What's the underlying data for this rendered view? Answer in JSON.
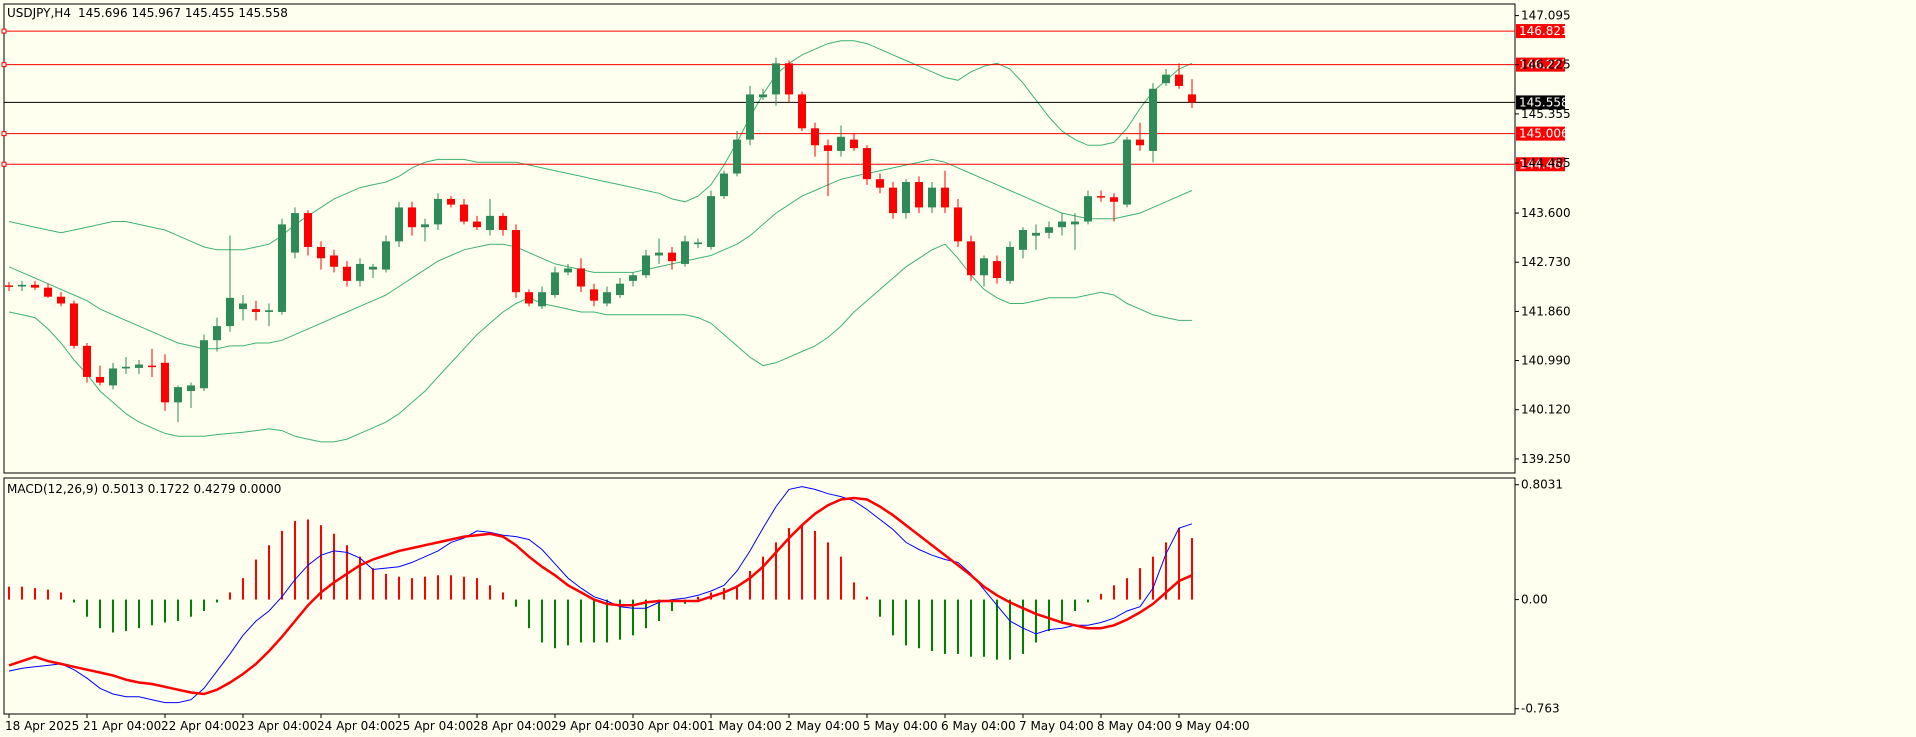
{
  "main_panel": {
    "symbol_label": "USDJPY,H4",
    "ohlc": "145.696 145.967 145.455 145.558",
    "price_ticks": [
      "147.095",
      "146.225",
      "145.355",
      "144.485",
      "143.600",
      "142.730",
      "141.860",
      "140.990",
      "140.120",
      "139.250"
    ],
    "current_price": "145.558",
    "levels": [
      "146.821",
      "146.227",
      "145.006",
      "144.464"
    ]
  },
  "macd_panel": {
    "label": "MACD(12,26,9) 0.5013 0.1722 0.4279 0.0000",
    "ticks": [
      "0.8031",
      "0.00",
      "-0.763"
    ]
  },
  "time_labels": [
    "18 Apr 2025",
    "21 Apr 04:00",
    "22 Apr 04:00",
    "23 Apr 04:00",
    "24 Apr 04:00",
    "25 Apr 04:00",
    "28 Apr 04:00",
    "29 Apr 04:00",
    "30 Apr 04:00",
    "1 May 04:00",
    "2 May 04:00",
    "5 May 04:00",
    "6 May 04:00",
    "7 May 04:00",
    "8 May 04:00",
    "9 May 04:00"
  ],
  "colors": {
    "background": "#fffff0",
    "bull_candle": "#2e8b57",
    "bear_candle": "#ff0000",
    "bollinger": "#3cb371",
    "macd_line": "#0000ff",
    "signal_line": "#ff0000",
    "level_line": "#ff0000",
    "current_line": "#000000"
  },
  "chart_data": {
    "type": "candlestick",
    "symbol": "USDJPY",
    "timeframe": "H4",
    "ylim": [
      139.0,
      147.3
    ],
    "candles": [
      {
        "o": 142.32,
        "h": 142.38,
        "l": 142.22,
        "c": 142.3
      },
      {
        "o": 142.3,
        "h": 142.4,
        "l": 142.22,
        "c": 142.33
      },
      {
        "o": 142.33,
        "h": 142.4,
        "l": 142.24,
        "c": 142.28
      },
      {
        "o": 142.28,
        "h": 142.35,
        "l": 142.1,
        "c": 142.12
      },
      {
        "o": 142.12,
        "h": 142.2,
        "l": 141.95,
        "c": 142.0
      },
      {
        "o": 142.0,
        "h": 142.05,
        "l": 141.2,
        "c": 141.25
      },
      {
        "o": 141.25,
        "h": 141.3,
        "l": 140.6,
        "c": 140.7
      },
      {
        "o": 140.7,
        "h": 140.9,
        "l": 140.55,
        "c": 140.6
      },
      {
        "o": 140.55,
        "h": 140.95,
        "l": 140.48,
        "c": 140.85
      },
      {
        "o": 140.85,
        "h": 141.05,
        "l": 140.75,
        "c": 140.88
      },
      {
        "o": 140.86,
        "h": 141.0,
        "l": 140.75,
        "c": 140.92
      },
      {
        "o": 140.9,
        "h": 141.2,
        "l": 140.7,
        "c": 140.88
      },
      {
        "o": 140.95,
        "h": 141.1,
        "l": 140.1,
        "c": 140.25
      },
      {
        "o": 140.25,
        "h": 140.55,
        "l": 139.9,
        "c": 140.52
      },
      {
        "o": 140.45,
        "h": 140.6,
        "l": 140.15,
        "c": 140.55
      },
      {
        "o": 140.5,
        "h": 141.45,
        "l": 140.45,
        "c": 141.35
      },
      {
        "o": 141.35,
        "h": 141.75,
        "l": 141.15,
        "c": 141.6
      },
      {
        "o": 141.6,
        "h": 143.2,
        "l": 141.5,
        "c": 142.1
      },
      {
        "o": 141.9,
        "h": 142.15,
        "l": 141.7,
        "c": 142.0
      },
      {
        "o": 141.9,
        "h": 142.05,
        "l": 141.7,
        "c": 141.85
      },
      {
        "o": 141.85,
        "h": 142.0,
        "l": 141.6,
        "c": 141.88
      },
      {
        "o": 141.85,
        "h": 143.5,
        "l": 141.8,
        "c": 143.4
      },
      {
        "o": 142.9,
        "h": 143.7,
        "l": 142.8,
        "c": 143.6
      },
      {
        "o": 143.6,
        "h": 143.65,
        "l": 142.85,
        "c": 143.0
      },
      {
        "o": 143.0,
        "h": 143.1,
        "l": 142.6,
        "c": 142.8
      },
      {
        "o": 142.85,
        "h": 142.95,
        "l": 142.55,
        "c": 142.65
      },
      {
        "o": 142.65,
        "h": 142.75,
        "l": 142.3,
        "c": 142.4
      },
      {
        "o": 142.4,
        "h": 142.8,
        "l": 142.3,
        "c": 142.7
      },
      {
        "o": 142.6,
        "h": 142.7,
        "l": 142.45,
        "c": 142.65
      },
      {
        "o": 142.6,
        "h": 143.2,
        "l": 142.55,
        "c": 143.1
      },
      {
        "o": 143.1,
        "h": 143.8,
        "l": 143.0,
        "c": 143.7
      },
      {
        "o": 143.7,
        "h": 143.8,
        "l": 143.2,
        "c": 143.35
      },
      {
        "o": 143.35,
        "h": 143.5,
        "l": 143.1,
        "c": 143.4
      },
      {
        "o": 143.4,
        "h": 143.95,
        "l": 143.3,
        "c": 143.85
      },
      {
        "o": 143.85,
        "h": 143.9,
        "l": 143.7,
        "c": 143.75
      },
      {
        "o": 143.75,
        "h": 143.85,
        "l": 143.4,
        "c": 143.45
      },
      {
        "o": 143.45,
        "h": 143.55,
        "l": 143.3,
        "c": 143.35
      },
      {
        "o": 143.3,
        "h": 143.85,
        "l": 143.2,
        "c": 143.55
      },
      {
        "o": 143.55,
        "h": 143.6,
        "l": 143.2,
        "c": 143.3
      },
      {
        "o": 143.3,
        "h": 143.4,
        "l": 142.1,
        "c": 142.2
      },
      {
        "o": 142.2,
        "h": 142.25,
        "l": 141.95,
        "c": 142.0
      },
      {
        "o": 141.95,
        "h": 142.3,
        "l": 141.9,
        "c": 142.2
      },
      {
        "o": 142.15,
        "h": 142.65,
        "l": 142.1,
        "c": 142.55
      },
      {
        "o": 142.55,
        "h": 142.7,
        "l": 142.5,
        "c": 142.62
      },
      {
        "o": 142.62,
        "h": 142.8,
        "l": 142.2,
        "c": 142.3
      },
      {
        "o": 142.25,
        "h": 142.35,
        "l": 141.95,
        "c": 142.05
      },
      {
        "o": 142.0,
        "h": 142.3,
        "l": 141.95,
        "c": 142.2
      },
      {
        "o": 142.15,
        "h": 142.45,
        "l": 142.1,
        "c": 142.35
      },
      {
        "o": 142.4,
        "h": 142.55,
        "l": 142.3,
        "c": 142.5
      },
      {
        "o": 142.5,
        "h": 142.95,
        "l": 142.45,
        "c": 142.85
      },
      {
        "o": 142.85,
        "h": 143.15,
        "l": 142.7,
        "c": 142.9
      },
      {
        "o": 142.9,
        "h": 143.0,
        "l": 142.6,
        "c": 142.75
      },
      {
        "o": 142.7,
        "h": 143.2,
        "l": 142.65,
        "c": 143.1
      },
      {
        "o": 143.05,
        "h": 143.15,
        "l": 142.98,
        "c": 143.08
      },
      {
        "o": 143.0,
        "h": 144.0,
        "l": 142.95,
        "c": 143.9
      },
      {
        "o": 143.9,
        "h": 144.35,
        "l": 143.85,
        "c": 144.3
      },
      {
        "o": 144.3,
        "h": 145.05,
        "l": 144.25,
        "c": 144.9
      },
      {
        "o": 144.9,
        "h": 145.85,
        "l": 144.8,
        "c": 145.7
      },
      {
        "o": 145.65,
        "h": 145.8,
        "l": 145.6,
        "c": 145.7
      },
      {
        "o": 145.7,
        "h": 146.35,
        "l": 145.5,
        "c": 146.25
      },
      {
        "o": 146.25,
        "h": 146.3,
        "l": 145.55,
        "c": 145.7
      },
      {
        "o": 145.7,
        "h": 145.75,
        "l": 145.05,
        "c": 145.1
      },
      {
        "o": 145.1,
        "h": 145.2,
        "l": 144.6,
        "c": 144.8
      },
      {
        "o": 144.8,
        "h": 144.9,
        "l": 143.9,
        "c": 144.7
      },
      {
        "o": 144.7,
        "h": 145.15,
        "l": 144.6,
        "c": 144.95
      },
      {
        "o": 144.9,
        "h": 145.0,
        "l": 144.7,
        "c": 144.75
      },
      {
        "o": 144.75,
        "h": 144.8,
        "l": 144.1,
        "c": 144.2
      },
      {
        "o": 144.2,
        "h": 144.3,
        "l": 143.95,
        "c": 144.05
      },
      {
        "o": 144.05,
        "h": 144.15,
        "l": 143.5,
        "c": 143.6
      },
      {
        "o": 143.6,
        "h": 144.2,
        "l": 143.5,
        "c": 144.15
      },
      {
        "o": 144.15,
        "h": 144.25,
        "l": 143.6,
        "c": 143.7
      },
      {
        "o": 143.7,
        "h": 144.15,
        "l": 143.6,
        "c": 144.05
      },
      {
        "o": 144.05,
        "h": 144.35,
        "l": 143.6,
        "c": 143.7
      },
      {
        "o": 143.7,
        "h": 143.85,
        "l": 143.0,
        "c": 143.1
      },
      {
        "o": 143.1,
        "h": 143.2,
        "l": 142.4,
        "c": 142.5
      },
      {
        "o": 142.5,
        "h": 142.85,
        "l": 142.3,
        "c": 142.8
      },
      {
        "o": 142.75,
        "h": 142.85,
        "l": 142.35,
        "c": 142.45
      },
      {
        "o": 142.4,
        "h": 143.1,
        "l": 142.35,
        "c": 143.0
      },
      {
        "o": 142.95,
        "h": 143.35,
        "l": 142.8,
        "c": 143.3
      },
      {
        "o": 143.2,
        "h": 143.4,
        "l": 142.95,
        "c": 143.25
      },
      {
        "o": 143.25,
        "h": 143.45,
        "l": 143.15,
        "c": 143.35
      },
      {
        "o": 143.35,
        "h": 143.6,
        "l": 143.2,
        "c": 143.45
      },
      {
        "o": 143.4,
        "h": 143.6,
        "l": 142.95,
        "c": 143.45
      },
      {
        "o": 143.45,
        "h": 144.0,
        "l": 143.4,
        "c": 143.9
      },
      {
        "o": 143.9,
        "h": 144.0,
        "l": 143.8,
        "c": 143.88
      },
      {
        "o": 143.88,
        "h": 143.95,
        "l": 143.45,
        "c": 143.8
      },
      {
        "o": 143.75,
        "h": 144.95,
        "l": 143.7,
        "c": 144.9
      },
      {
        "o": 144.9,
        "h": 145.2,
        "l": 144.7,
        "c": 144.8
      },
      {
        "o": 144.7,
        "h": 145.9,
        "l": 144.5,
        "c": 145.8
      },
      {
        "o": 145.9,
        "h": 146.15,
        "l": 145.85,
        "c": 146.05
      },
      {
        "o": 146.05,
        "h": 146.25,
        "l": 145.8,
        "c": 145.85
      },
      {
        "o": 145.7,
        "h": 145.97,
        "l": 145.46,
        "c": 145.56
      }
    ],
    "bollinger_middle": [
      142.65,
      142.55,
      142.45,
      142.35,
      142.25,
      142.15,
      142.05,
      141.9,
      141.8,
      141.7,
      141.6,
      141.5,
      141.4,
      141.3,
      141.25,
      141.2,
      141.2,
      141.25,
      141.25,
      141.3,
      141.3,
      141.35,
      141.45,
      141.55,
      141.65,
      141.75,
      141.85,
      141.95,
      142.05,
      142.15,
      142.3,
      142.45,
      142.6,
      142.75,
      142.85,
      142.95,
      143.0,
      143.05,
      143.05,
      143.0,
      142.9,
      142.8,
      142.7,
      142.65,
      142.6,
      142.55,
      142.55,
      142.55,
      142.55,
      142.6,
      142.65,
      142.7,
      142.75,
      142.8,
      142.85,
      142.95,
      143.05,
      143.2,
      143.4,
      143.6,
      143.75,
      143.9,
      144.0,
      144.1,
      144.2,
      144.25,
      144.3,
      144.35,
      144.4,
      144.45,
      144.5,
      144.55,
      144.5,
      144.4,
      144.3,
      144.2,
      144.1,
      144.0,
      143.9,
      143.8,
      143.7,
      143.6,
      143.55,
      143.5,
      143.5,
      143.5,
      143.55,
      143.6,
      143.7,
      143.8,
      143.9,
      144.0
    ],
    "bollinger_upper": [
      143.45,
      143.4,
      143.35,
      143.3,
      143.25,
      143.3,
      143.35,
      143.4,
      143.45,
      143.45,
      143.4,
      143.35,
      143.3,
      143.2,
      143.1,
      143.0,
      142.95,
      142.95,
      142.95,
      143.0,
      143.05,
      143.2,
      143.4,
      143.55,
      143.7,
      143.85,
      143.95,
      144.05,
      144.1,
      144.15,
      144.25,
      144.4,
      144.5,
      144.55,
      144.55,
      144.55,
      144.5,
      144.5,
      144.5,
      144.5,
      144.45,
      144.4,
      144.35,
      144.3,
      144.25,
      144.2,
      144.15,
      144.1,
      144.05,
      144.0,
      143.95,
      143.85,
      143.8,
      143.9,
      144.1,
      144.45,
      144.85,
      145.3,
      145.7,
      146.05,
      146.25,
      146.4,
      146.5,
      146.6,
      146.65,
      146.65,
      146.6,
      146.5,
      146.4,
      146.3,
      146.2,
      146.1,
      146.0,
      145.95,
      146.1,
      146.2,
      146.25,
      146.15,
      145.9,
      145.6,
      145.3,
      145.05,
      144.9,
      144.8,
      144.8,
      144.85,
      145.1,
      145.45,
      145.75,
      145.95,
      146.15,
      146.25
    ],
    "bollinger_lower": [
      141.85,
      141.8,
      141.75,
      141.55,
      141.3,
      141.0,
      140.75,
      140.45,
      140.25,
      140.05,
      139.9,
      139.8,
      139.7,
      139.65,
      139.65,
      139.65,
      139.68,
      139.7,
      139.72,
      139.75,
      139.78,
      139.75,
      139.65,
      139.6,
      139.55,
      139.55,
      139.6,
      139.7,
      139.8,
      139.9,
      140.05,
      140.25,
      140.45,
      140.7,
      140.95,
      141.2,
      141.45,
      141.65,
      141.85,
      142.0,
      142.1,
      142.0,
      141.95,
      141.9,
      141.85,
      141.85,
      141.8,
      141.8,
      141.8,
      141.8,
      141.8,
      141.8,
      141.8,
      141.75,
      141.65,
      141.45,
      141.25,
      141.05,
      140.9,
      140.95,
      141.05,
      141.15,
      141.25,
      141.4,
      141.6,
      141.85,
      142.05,
      142.25,
      142.45,
      142.65,
      142.8,
      142.95,
      143.05,
      142.8,
      142.5,
      142.25,
      142.1,
      142.0,
      142.0,
      142.05,
      142.1,
      142.1,
      142.1,
      142.15,
      142.2,
      142.15,
      142.0,
      141.9,
      141.8,
      141.75,
      141.7,
      141.7
    ],
    "macd_ylim": [
      -0.8,
      0.85
    ],
    "macd_histogram": [
      0.09,
      0.09,
      0.08,
      0.07,
      0.05,
      -0.02,
      -0.12,
      -0.2,
      -0.23,
      -0.22,
      -0.2,
      -0.18,
      -0.16,
      -0.15,
      -0.12,
      -0.08,
      -0.02,
      0.05,
      0.15,
      0.28,
      0.38,
      0.48,
      0.55,
      0.56,
      0.52,
      0.46,
      0.38,
      0.3,
      0.22,
      0.18,
      0.16,
      0.15,
      0.16,
      0.17,
      0.17,
      0.16,
      0.15,
      0.1,
      0.05,
      -0.05,
      -0.2,
      -0.3,
      -0.34,
      -0.32,
      -0.3,
      -0.3,
      -0.3,
      -0.28,
      -0.25,
      -0.2,
      -0.15,
      -0.08,
      -0.03,
      0.02,
      0.05,
      0.08,
      0.1,
      0.2,
      0.3,
      0.4,
      0.5,
      0.52,
      0.48,
      0.4,
      0.3,
      0.12,
      0.02,
      -0.12,
      -0.25,
      -0.32,
      -0.34,
      -0.36,
      -0.38,
      -0.38,
      -0.4,
      -0.4,
      -0.42,
      -0.42,
      -0.38,
      -0.3,
      -0.22,
      -0.15,
      -0.08,
      -0.02,
      0.04,
      0.1,
      0.15,
      0.22,
      0.3,
      0.4,
      0.5,
      0.43
    ],
    "macd_line": [
      -0.5,
      -0.48,
      -0.47,
      -0.46,
      -0.45,
      -0.49,
      -0.55,
      -0.62,
      -0.66,
      -0.68,
      -0.68,
      -0.7,
      -0.72,
      -0.72,
      -0.7,
      -0.62,
      -0.5,
      -0.38,
      -0.25,
      -0.15,
      -0.08,
      0.02,
      0.14,
      0.24,
      0.31,
      0.34,
      0.33,
      0.29,
      0.21,
      0.22,
      0.23,
      0.26,
      0.3,
      0.34,
      0.4,
      0.43,
      0.48,
      0.47,
      0.45,
      0.44,
      0.42,
      0.35,
      0.25,
      0.15,
      0.08,
      0.02,
      -0.01,
      -0.05,
      -0.06,
      -0.06,
      -0.02,
      0.0,
      0.01,
      0.03,
      0.06,
      0.1,
      0.2,
      0.34,
      0.5,
      0.65,
      0.77,
      0.79,
      0.77,
      0.74,
      0.72,
      0.69,
      0.63,
      0.56,
      0.49,
      0.4,
      0.35,
      0.31,
      0.28,
      0.26,
      0.18,
      0.07,
      -0.04,
      -0.15,
      -0.2,
      -0.24,
      -0.21,
      -0.2,
      -0.18,
      -0.18,
      -0.16,
      -0.13,
      -0.08,
      -0.05,
      0.08,
      0.32,
      0.5,
      0.53
    ],
    "signal_line": [
      -0.46,
      -0.43,
      -0.4,
      -0.43,
      -0.45,
      -0.47,
      -0.49,
      -0.51,
      -0.53,
      -0.56,
      -0.58,
      -0.59,
      -0.61,
      -0.63,
      -0.65,
      -0.66,
      -0.63,
      -0.58,
      -0.52,
      -0.45,
      -0.36,
      -0.26,
      -0.15,
      -0.04,
      0.05,
      0.12,
      0.18,
      0.24,
      0.28,
      0.31,
      0.34,
      0.36,
      0.38,
      0.4,
      0.42,
      0.44,
      0.45,
      0.46,
      0.44,
      0.38,
      0.3,
      0.23,
      0.17,
      0.1,
      0.05,
      0.0,
      -0.03,
      -0.04,
      -0.04,
      -0.02,
      -0.01,
      -0.01,
      -0.01,
      -0.01,
      0.02,
      0.05,
      0.09,
      0.15,
      0.23,
      0.33,
      0.43,
      0.52,
      0.6,
      0.66,
      0.7,
      0.71,
      0.7,
      0.65,
      0.59,
      0.52,
      0.45,
      0.38,
      0.31,
      0.24,
      0.17,
      0.09,
      0.03,
      -0.02,
      -0.06,
      -0.1,
      -0.13,
      -0.16,
      -0.18,
      -0.2,
      -0.2,
      -0.18,
      -0.14,
      -0.09,
      -0.03,
      0.05,
      0.13,
      0.17
    ]
  }
}
